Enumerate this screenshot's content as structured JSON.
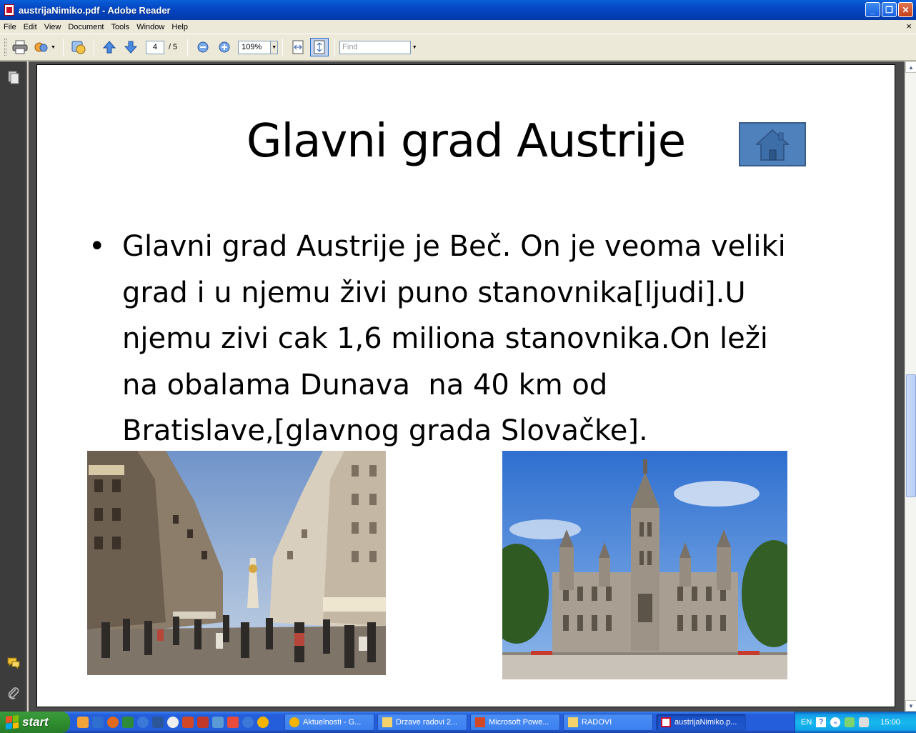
{
  "window": {
    "title": "austrijaNimiko.pdf - Adobe Reader",
    "minimize": "_",
    "restore": "❐",
    "close": "✕"
  },
  "menu": {
    "items": [
      "File",
      "Edit",
      "View",
      "Document",
      "Tools",
      "Window",
      "Help"
    ],
    "close_glyph": "×"
  },
  "toolbar": {
    "current_page": "4",
    "total_pages": "/ 5",
    "zoom": "109%",
    "find_placeholder": "Find"
  },
  "slide": {
    "title": "Glavni grad Austrije",
    "bullet_glyph": "•",
    "bullet_lines": [
      "Glavni grad Austrije je Beč. On je veoma veliki",
      "grad i u njemu živi puno stanovnika[ljudi].U",
      "njemu zivi cak 1,6 miliona stanovnika.On leži",
      "na obalama Dunava  na 40 km od",
      "Bratislave,[glavnog grada Slovačke]."
    ]
  },
  "taskbar": {
    "start_label": "start",
    "tasks": [
      {
        "label": "Aktuelnosti - G...",
        "icon": "chrome-icon"
      },
      {
        "label": "Drzave radovi 2...",
        "icon": "folder-icon"
      },
      {
        "label": "Microsoft Powe...",
        "icon": "powerpoint-icon"
      },
      {
        "label": "RADOVI",
        "icon": "folder-icon"
      },
      {
        "label": "austrijaNimiko.p...",
        "icon": "pdf-icon"
      }
    ],
    "tray_lang": "EN",
    "clock": "15:00"
  },
  "colors": {
    "home_button": "#4f81bd",
    "xp_blue": "#245edb",
    "start_green": "#2f8f2f"
  }
}
